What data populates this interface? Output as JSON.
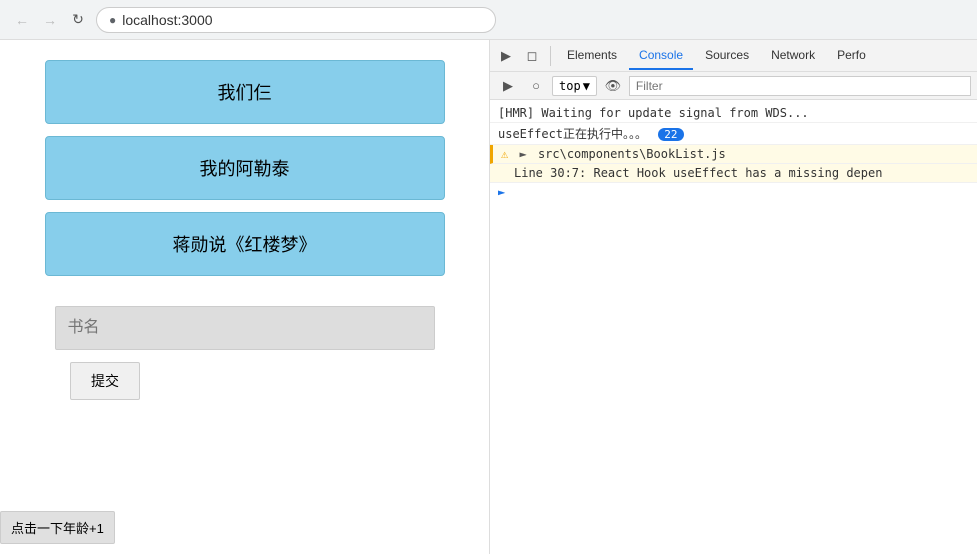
{
  "browser": {
    "back_disabled": true,
    "forward_disabled": true,
    "url": "localhost:3000"
  },
  "app": {
    "books": [
      {
        "title": "我们仨"
      },
      {
        "title": "我的阿勒泰"
      },
      {
        "title": "蒋勋说《红楼梦》"
      }
    ],
    "input_placeholder": "书名",
    "submit_label": "提交",
    "age_btn_label": "点击一下年龄+1"
  },
  "devtools": {
    "tabs": [
      {
        "label": "Elements",
        "active": false
      },
      {
        "label": "Console",
        "active": true
      },
      {
        "label": "Sources",
        "active": false
      },
      {
        "label": "Network",
        "active": false
      },
      {
        "label": "Perfo",
        "active": false
      }
    ],
    "toolbar": {
      "top_select": "top",
      "filter_placeholder": "Filter"
    },
    "console": {
      "lines": [
        {
          "type": "normal",
          "text": "[HMR] Waiting for update signal from WDS..."
        },
        {
          "type": "count",
          "text": "useEffect正在执行中。。。",
          "count": "22"
        },
        {
          "type": "warning",
          "file": "src\\components\\BookList.js"
        },
        {
          "type": "warning-sub",
          "text": "Line 30:7:  React Hook useEffect has a missing depen"
        }
      ]
    }
  }
}
